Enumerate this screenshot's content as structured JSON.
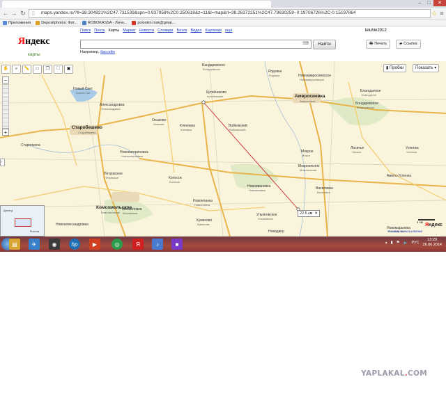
{
  "browser": {
    "url": "maps.yandex.ru/?ll=38.304921%2C47.731539&spn=0.937958%2C0.250618&z=11&l=map&rl=38.26372251%2C47.79630259~0.19706726%2C-0.15197864",
    "window_controls": {
      "minimize": "–",
      "maximize": "□",
      "close": "✕"
    },
    "bookmarks": [
      {
        "label": "Приложения",
        "color": "#5a8ad8"
      },
      {
        "label": "Depositphotos: Фот...",
        "color": "#e0a020"
      },
      {
        "label": "ROBOKASSA - Личн...",
        "color": "#4d7fc4"
      },
      {
        "label": "poloskin.msk@gmai...",
        "color": "#d93025"
      }
    ]
  },
  "yandex": {
    "logo_first": "Я",
    "logo_rest": "ндекс",
    "logo_sub": "карты",
    "services": [
      "Поиск",
      "Почта",
      "Карты",
      "Маркет",
      "Новости",
      "Словари",
      "Блоги",
      "Видео",
      "Картинки",
      "ещё"
    ],
    "current_service": "Карты",
    "user": "leluhin2012",
    "search_value": "",
    "find_label": "Найти",
    "example_prefix": "Например,",
    "example_link": "бассейн",
    "print_label": "Печать",
    "link_label": "Ссылка"
  },
  "map": {
    "traffic_label": "Пробки",
    "show_label": "Показать",
    "distance": "22.5 км",
    "scale_label": "4 км",
    "brand_first": "Я",
    "brand_rest": "ндекс",
    "terms": "Условия использования",
    "cities": [
      {
        "name": "Старобешево",
        "sub": "Старобешево"
      },
      {
        "name": "Амвросиевка",
        "sub": "Амвросіївка"
      },
      {
        "name": "Комсомольское",
        "sub": "Комсомольске"
      }
    ],
    "villages": [
      {
        "name": "Новый Свет",
        "sub": "Новий Світ"
      },
      {
        "name": "Александровка",
        "sub": "Олександрівка"
      },
      {
        "name": "Осыково",
        "sub": "Осикове"
      },
      {
        "name": "Кленовка",
        "sub": "Кленівка"
      },
      {
        "name": "Кутейниково",
        "sub": "Кутейникове"
      },
      {
        "name": "Войковский",
        "sub": "Войковський"
      },
      {
        "name": "Бандаревское",
        "sub": "Бондарівське"
      },
      {
        "name": "Родники",
        "sub": "Родники"
      },
      {
        "name": "Новоамвросиевское",
        "sub": "Новоамвросіївське"
      },
      {
        "name": "Благодатное",
        "sub": "Благодатне"
      },
      {
        "name": "Бондаревское",
        "sub": "Бондарівське"
      },
      {
        "name": "Новокатериновка",
        "sub": "Новокатеринівка"
      },
      {
        "name": "Петровское",
        "sub": "Петрівське"
      },
      {
        "name": "Колосок",
        "sub": "Колосок"
      },
      {
        "name": "Новоивановка",
        "sub": "Новоіванівка"
      },
      {
        "name": "Мокрое",
        "sub": "Мокре"
      },
      {
        "name": "Мокроельчик",
        "sub": "Мокроєльчик"
      },
      {
        "name": "Василевка",
        "sub": "Василівка"
      },
      {
        "name": "Успенка",
        "sub": "Успенка"
      },
      {
        "name": "Лисичье",
        "sub": "Лисиче"
      },
      {
        "name": "Авило-Успенка",
        "sub": ""
      },
      {
        "name": "Новоеланка",
        "sub": "Новоєланка"
      },
      {
        "name": "Михайловка",
        "sub": "Михайлівка"
      },
      {
        "name": "Кумачово",
        "sub": "Кумачове"
      },
      {
        "name": "Ульяновское",
        "sub": "Ульянівське"
      },
      {
        "name": "Новомарьевка",
        "sub": "Новомар'ївка"
      },
      {
        "name": "Новодвор",
        "sub": ""
      },
      {
        "name": "Староласпа",
        "sub": ""
      },
      {
        "name": "Новоалександровка",
        "sub": ""
      }
    ],
    "minimap_labels": [
      "Донецк",
      "Ростов"
    ]
  },
  "taskbar": {
    "apps": [
      {
        "name": "explorer",
        "glyph": "▤",
        "color": "#d8a433"
      },
      {
        "name": "app-blue",
        "glyph": "✈",
        "color": "#3a80c9"
      },
      {
        "name": "app-camera",
        "glyph": "◉",
        "color": "#3b3b3b"
      },
      {
        "name": "hp",
        "glyph": "hp",
        "color": "#1f6fb5"
      },
      {
        "name": "media",
        "glyph": "▶",
        "color": "#d04020"
      },
      {
        "name": "chrome",
        "glyph": "◎",
        "color": "#2c9b4a"
      },
      {
        "name": "yandex",
        "glyph": "Я",
        "color": "#d02020"
      },
      {
        "name": "audio",
        "glyph": "♪",
        "color": "#4a7bd0"
      },
      {
        "name": "tiles",
        "glyph": "■",
        "color": "#7a3ac8"
      }
    ],
    "language": "РУС",
    "time": "13:29",
    "date": "26.06.2014"
  },
  "watermark": {
    "part1": "YAPLAKAL",
    "dot": ".",
    "part2": "COM"
  }
}
